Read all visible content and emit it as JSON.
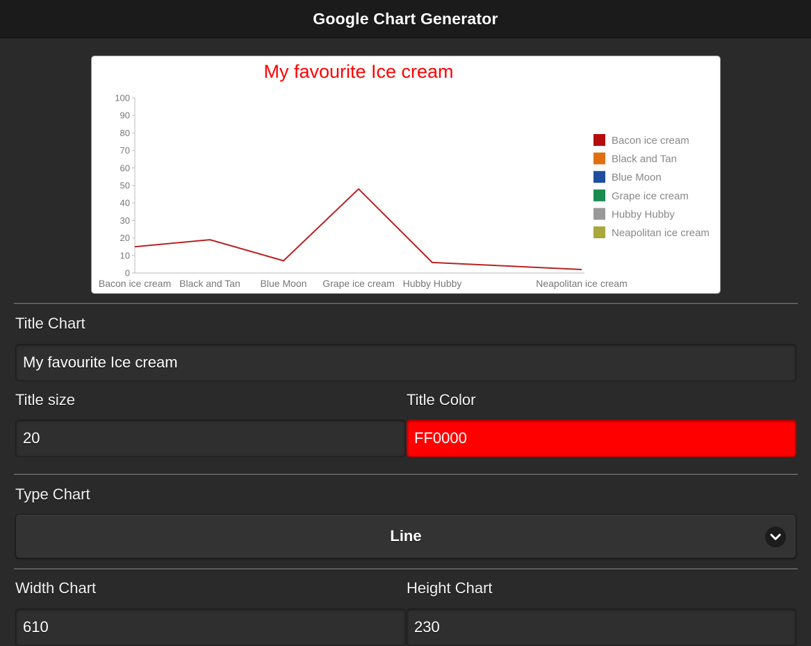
{
  "app": {
    "title": "Google Chart Generator"
  },
  "form": {
    "title_chart": {
      "label": "Title Chart",
      "value": "My favourite Ice cream"
    },
    "title_size": {
      "label": "Title size",
      "value": "20"
    },
    "title_color": {
      "label": "Title Color",
      "value": "FF0000"
    },
    "type_chart": {
      "label": "Type Chart",
      "value": "Line"
    },
    "width_chart": {
      "label": "Width Chart",
      "value": "610"
    },
    "height_chart": {
      "label": "Height Chart",
      "value": "230"
    }
  },
  "icons": {
    "select_toggle": "chevron-down-icon"
  },
  "colors": {
    "header_bg": "#1b1b1b",
    "page_bg": "#2a2a2a",
    "title_color_field": "#ff0000",
    "chart_title": "#ff0000",
    "line": "#b82222"
  },
  "chart_data": {
    "type": "line",
    "title": "My favourite Ice cream",
    "categories": [
      "Bacon ice cream",
      "Black and Tan",
      "Blue Moon",
      "Grape ice cream",
      "Hubby Hubby",
      "Neapolitan ice cream"
    ],
    "values": [
      15,
      19,
      7,
      48,
      6,
      2
    ],
    "ylim": [
      0,
      100
    ],
    "yticks": [
      0,
      10,
      20,
      30,
      40,
      50,
      60,
      70,
      80,
      90,
      100
    ],
    "grid": false,
    "legend_position": "right",
    "legend": [
      {
        "name": "Bacon ice cream",
        "color": "#b50c0c"
      },
      {
        "name": "Black and Tan",
        "color": "#e06f10"
      },
      {
        "name": "Blue Moon",
        "color": "#1f4e9e"
      },
      {
        "name": "Grape ice cream",
        "color": "#1a8c4f"
      },
      {
        "name": "Hubby Hubby",
        "color": "#999999"
      },
      {
        "name": "Neapolitan ice cream",
        "color": "#a9a83c"
      }
    ]
  }
}
